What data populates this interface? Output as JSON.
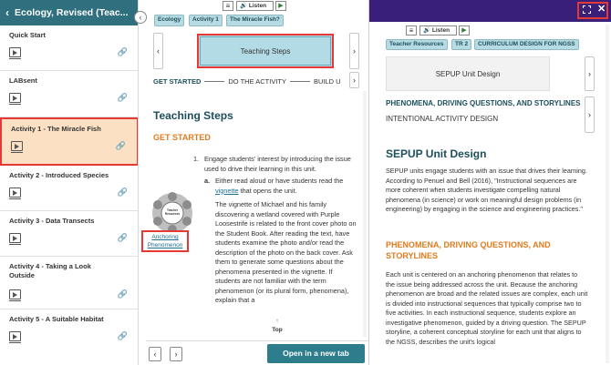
{
  "sidebar": {
    "title": "Ecology, Revised (Teac...",
    "back_icon": "chevron-left-icon",
    "items": [
      {
        "label": "Quick Start"
      },
      {
        "label": "LABsent"
      },
      {
        "label": "Activity 1 - The Miracle Fish"
      },
      {
        "label": "Activity 2 - Introduced Species"
      },
      {
        "label": "Activity 3 - Data Transects"
      },
      {
        "label": "Activity 4 - Taking a Look Outside"
      },
      {
        "label": "Activity 5 - A Suitable Habitat"
      }
    ],
    "toggle_glyph": "‹"
  },
  "middle": {
    "toolbar": {
      "listen": "Listen",
      "menu_glyph": "≡",
      "play_glyph": "▶"
    },
    "breadcrumbs": [
      "Ecology",
      "Activity 1",
      "The Miracle Fish?"
    ],
    "current_step": "Teaching Steps",
    "step_tabs": [
      "GET STARTED",
      "DO THE ACTIVITY",
      "BUILD U"
    ],
    "title": "Teaching Steps",
    "subtitle": "GET STARTED",
    "para1": "Engage students' interest by introducing the issue used to drive their learning in this unit.",
    "para1_num": "1.",
    "para_a_pre": "Either read aloud or have students read the",
    "para_a_link": "vignette",
    "para_a_post": "that opens the unit.",
    "para_a_label": "a.",
    "para_b": "The vignette of Michael and his family discovering a wetland covered with Purple Loosestrife is related to the front cover photo on the Student Book. After reading the text, have students examine the photo and/or read the description of the photo on the back cover. Ask them to generate some questions about the phenomena presented in the vignette. If students are not familiar with the term phenomenon (or its plural form, phenomena), explain that a",
    "hub_label": "Teacher Resources",
    "anchoring_link": "Anchoring Phenomenon",
    "top_label": "Top",
    "open_tab": "Open in a new tab"
  },
  "right": {
    "toolbar": {
      "listen": "Listen",
      "menu_glyph": "≡",
      "play_glyph": "▶"
    },
    "breadcrumbs": [
      "Teacher Resources",
      "TR 2",
      "CURRICULUM DESIGN FOR NGSS"
    ],
    "unit_box": "SEPUP Unit Design",
    "section1": "PHENOMENA, DRIVING QUESTIONS, AND STORYLINES",
    "section2": "INTENTIONAL ACTIVITY DESIGN",
    "title": "SEPUP Unit Design",
    "para1": "SEPUP units engage students with an issue that drives their learning. According to Penuel and Bell (2016), \"Instructional sequences are more coherent when students investigate compelling natural phenomena (in science) or work on meaningful design problems (in engineering) by engaging in the science and engineering practices.\"",
    "subtitle": "PHENOMENA, DRIVING QUESTIONS, AND STORYLINES",
    "para2": "Each unit is centered on an anchoring phenomenon that relates to the issue being addressed across the unit. Because the anchoring phenomenon are broad and the related issues are complex, each unit is divided into instructional sequences that typically comprise two to five activities. In each instructional sequence, students explore an investigative phenomenon, guided by a driving question. The SEPUP storyline, a coherent conceptual storyline for each unit that aligns to the NGSS, describes the unit's logical",
    "expand_icon": "expand-icon",
    "close_glyph": "✕"
  },
  "colors": {
    "sidebar_header": "#2f6f7e",
    "accent": "#1d4f5c",
    "orange": "#e07b1e",
    "highlight": "#fbe0c4",
    "red_outline": "#e53935",
    "right_header": "#3a1f7a",
    "button": "#2e7d8c"
  }
}
